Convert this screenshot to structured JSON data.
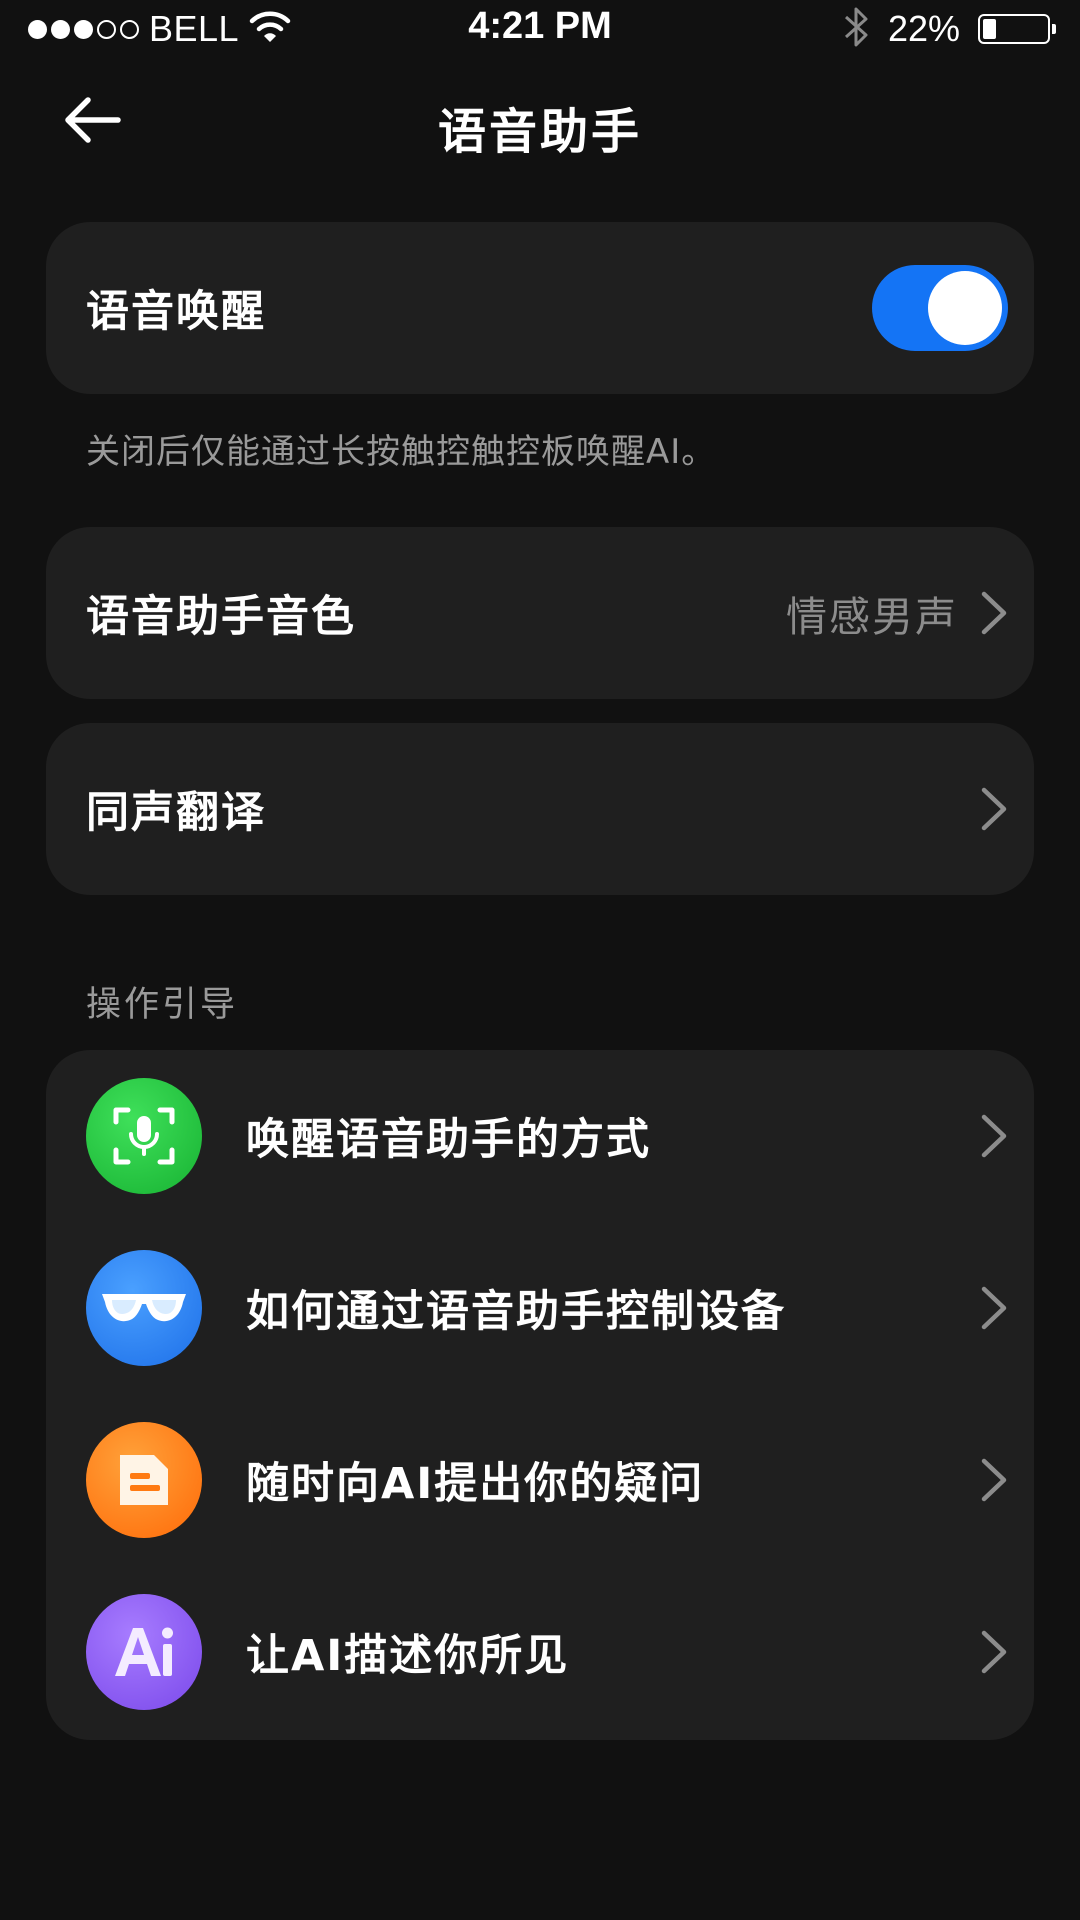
{
  "status_bar": {
    "carrier": "BELL",
    "signal_bars_filled": 3,
    "signal_bars_total": 5,
    "time": "4:21 PM",
    "battery_percent": "22%",
    "battery_level": 0.22,
    "icons": [
      "wifi-icon",
      "bluetooth-icon",
      "battery-icon"
    ]
  },
  "nav": {
    "title": "语音助手",
    "back_icon": "back-arrow-icon"
  },
  "voice_wake": {
    "label": "语音唤醒",
    "enabled": true,
    "note": "关闭后仅能通过长按触控触控板唤醒AI。"
  },
  "voice_timbre": {
    "label": "语音助手音色",
    "value": "情感男声"
  },
  "simultaneous_translation": {
    "label": "同声翻译"
  },
  "guide": {
    "section_title": "操作引导",
    "items": [
      {
        "label": "唤醒语音助手的方式",
        "icon": "voice-scan-mic-icon",
        "color": "#1ec83c"
      },
      {
        "label": "如何通过语音助手控制设备",
        "icon": "glasses-icon",
        "color": "#2a86f2"
      },
      {
        "label": "随时向AI提出你的疑问",
        "icon": "document-icon",
        "color": "#ff7a12"
      },
      {
        "label": "让AI描述你所见",
        "icon": "ai-icon",
        "color": "#8c5cf0"
      }
    ]
  },
  "colors": {
    "background": "#111111",
    "card": "#1f1f1f",
    "toggle_on": "#1474f5",
    "secondary_text": "#9a9a9a"
  }
}
